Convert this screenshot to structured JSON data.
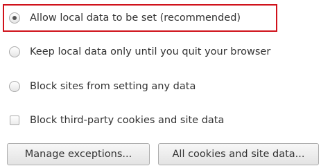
{
  "cookie_options": [
    {
      "label": "Allow local data to be set (recommended)",
      "type": "radio",
      "checked": true
    },
    {
      "label": "Keep local data only until you quit your browser",
      "type": "radio",
      "checked": false
    },
    {
      "label": "Block sites from setting any data",
      "type": "radio",
      "checked": false
    }
  ],
  "block_third_party": {
    "label": "Block third-party cookies and site data",
    "checked": false
  },
  "buttons": {
    "manage_exceptions": "Manage exceptions...",
    "all_cookies": "All cookies and site data..."
  },
  "colors": {
    "highlight_border": "#d0121b"
  }
}
